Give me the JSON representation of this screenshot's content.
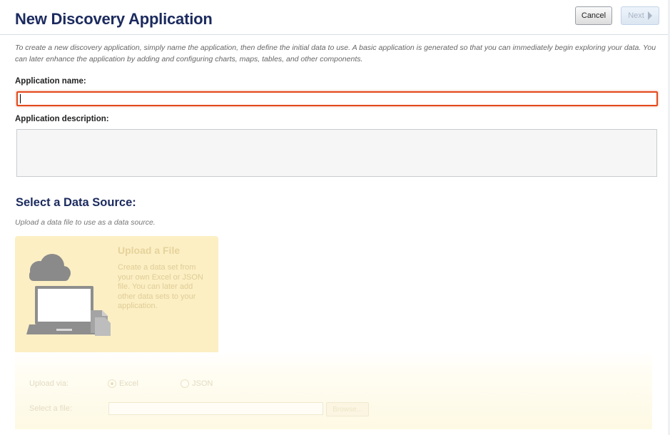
{
  "header": {
    "title": "New Discovery Application",
    "cancel_label": "Cancel",
    "next_label": "Next"
  },
  "intro_text": "To create a new discovery application, simply name the application, then define the initial data to use. A basic application is generated so that you can immediately begin exploring your data. You can later enhance the application by adding and configuring charts, maps, tables, and other components.",
  "form": {
    "name_label": "Application name:",
    "name_value": "",
    "description_label": "Application description:",
    "description_value": ""
  },
  "data_source": {
    "title": "Select a Data Source:",
    "subtitle": "Upload a data file to use as a data source.",
    "tile": {
      "title": "Upload a File",
      "description": "Create a data set from your own Excel or JSON file. You can later add other data sets to your application.",
      "icon": "laptop-cloud-upload-icon"
    },
    "upload": {
      "via_label": "Upload via:",
      "options": [
        "Excel",
        "JSON"
      ],
      "selected": "Excel",
      "file_label": "Select a file:",
      "file_value": "",
      "browse_label": "Browse..."
    }
  },
  "colors": {
    "title": "#1b2a5e",
    "focus_border": "#e2491c",
    "tile_background": "#fcefc4"
  }
}
